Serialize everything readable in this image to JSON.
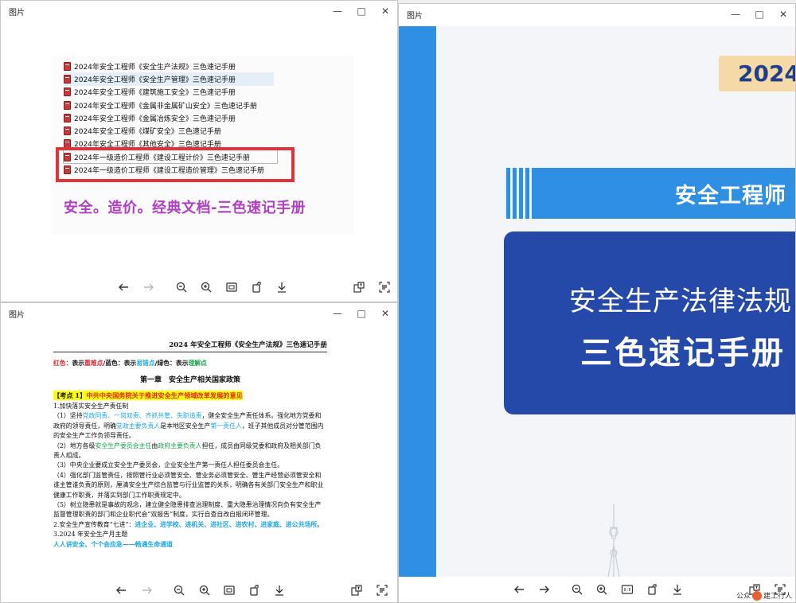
{
  "windows": {
    "top_left": {
      "title": "图片",
      "files": [
        "2024年安全工程师《安全生产法规》三色速记手册",
        "2024年安全工程师《安全生产管理》三色速记手册",
        "2024年安全工程师《建筑施工安全》三色速记手册",
        "2024年安全工程师《金属非金属矿山安全》三色速记手册",
        "2024年安全工程师《金属冶炼安全》三色速记手册",
        "2024年安全工程师《煤矿安全》三色速记手册",
        "2024年安全工程师《其他安全》三色速记手册",
        "2024年一级造价工程师《建设工程计价》三色速记手册",
        "2024年一级造价工程师《建设工程造价管理》三色速记手册"
      ],
      "caption": "安全。造价。经典文档-三色速记手册"
    },
    "bottom_left": {
      "title": "图片",
      "doc": {
        "header": "2024 年安全工程师《安全生产法规》三色速记手册",
        "legend": {
          "red_label": "红色：",
          "red_desc": "表示",
          "red_term": "重难点",
          "sep1": "/蓝色：表示",
          "blue_term": "易错点",
          "sep2": "/绿色：表示",
          "green_term": "理解点"
        },
        "chapter": "第一章　安全生产相关国家政策",
        "kaodian_tag": "【考点 1】",
        "kaodian_text": "中共中央国务院关于推进安全生产领域改革发展的意见",
        "p1": "1.加快落实安全生产责任制",
        "p2a": "（1）坚持",
        "p2b": "党政同责、一岗双责、齐抓共管、失职追责",
        "p2c": "，健全安全生产责任体系。强化地方党委和政府的领导责任，明确",
        "p2d": "党政主要负责人",
        "p2e": "是本地区安全生产",
        "p2f": "第一责任人",
        "p2g": "，班子其他成员对分管范围内的安全生产工作负领导责任。",
        "p3a": "（2）地方各级",
        "p3b": "安全生产委员会主任",
        "p3c": "由",
        "p3d": "政府主要负责人",
        "p3e": "担任，成员由同级党委和政府及相关部门负责人组成。",
        "p4": "（3）中央企业要成立安全生产委员会，企业安全生产第一责任人担任委员会主任。",
        "p5": "（4）强化部门监管责任，按照管行业必须管安全、管业务必须管安全、管生产经营必须管安全和谁主管谁负责的原则，厘清安全生产综合监管与行业监管的关系，明确各有关部门安全生产和职业健康工作职责，并落实到部门工作职责规定中。",
        "p6": "（5）树立隐患就是事故的观念，建立健全隐患排查治理制度、重大隐患治理情况向负有安全生产监督管理职责的部门和企业职代会“双报告”制度，实行自查自改自报闭环管理。",
        "p7a": "2.安全生产宣传教育“七进”：",
        "p7b": "进企业、进学校、进机关、进社区、进农村、进家庭、进公共场所",
        "p7c": "。",
        "p8": "3.2024 年安全生产月主题",
        "p9": "人人讲安全、个个会应急——畅通生命通道"
      }
    },
    "right": {
      "title": "图片",
      "badge": "2024",
      "band_text": "安全工程师",
      "panel_line1": "安全生产法律法规",
      "panel_line2": "三色速记手册",
      "watermark_a": "公众",
      "watermark_b": "建工行人"
    }
  },
  "icons": {
    "minimize": "minimize-icon",
    "maximize": "maximize-icon",
    "close": "close-icon"
  }
}
